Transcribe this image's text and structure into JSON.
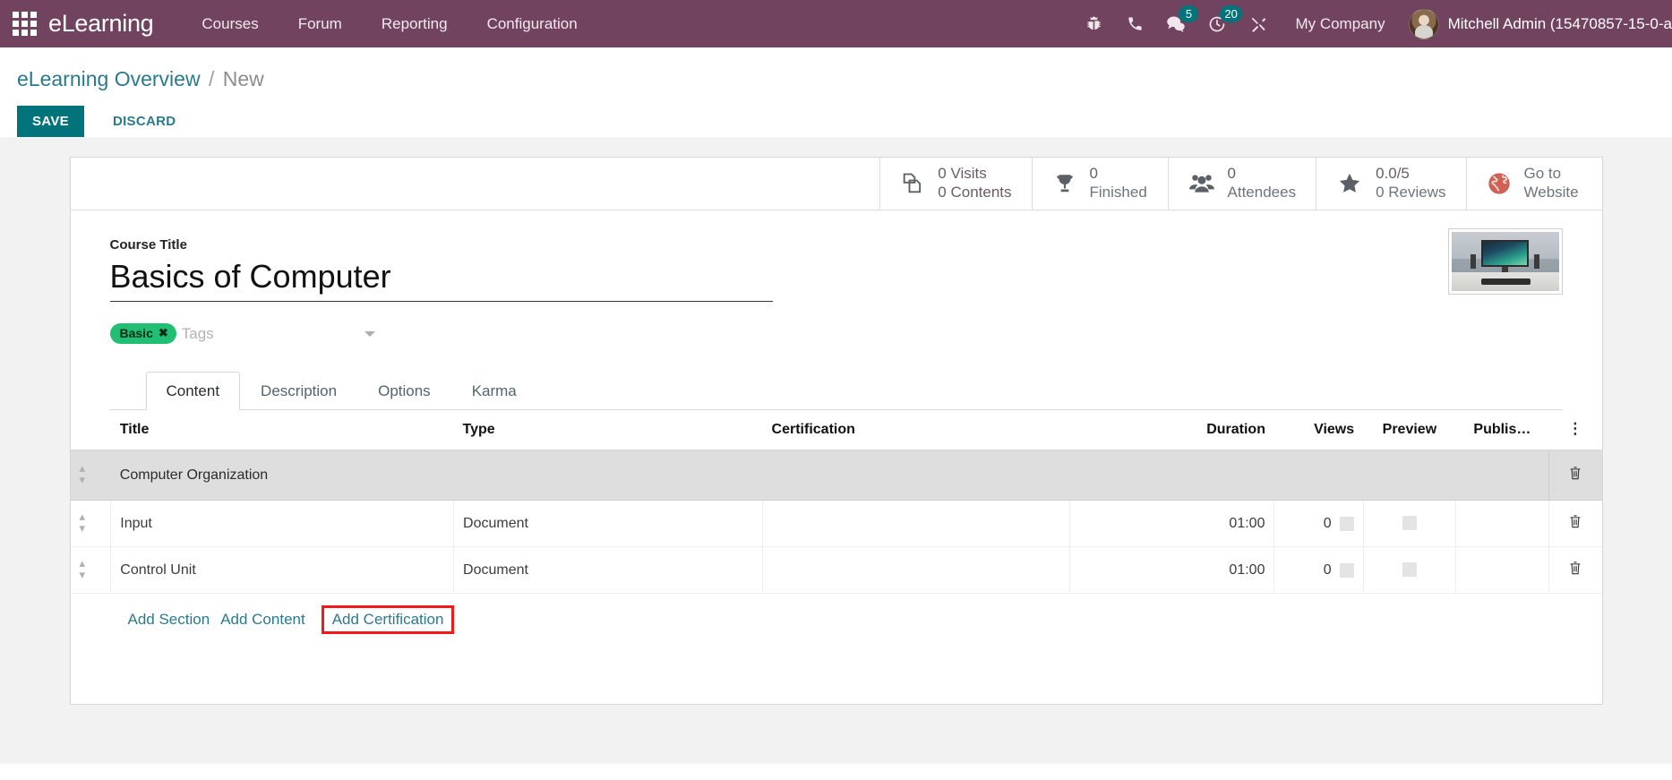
{
  "navbar": {
    "apps_icon": "apps-grid-icon",
    "brand": "eLearning",
    "menu": [
      {
        "label": "Courses"
      },
      {
        "label": "Forum"
      },
      {
        "label": "Reporting"
      },
      {
        "label": "Configuration"
      }
    ],
    "icons": [
      {
        "name": "bug-icon",
        "badge": null
      },
      {
        "name": "phone-icon",
        "badge": null
      },
      {
        "name": "messages-icon",
        "badge": "5"
      },
      {
        "name": "activities-clock-icon",
        "badge": "20"
      },
      {
        "name": "tools-icon",
        "badge": null
      }
    ],
    "company": "My Company",
    "username": "Mitchell Admin (15470857-15-0-a",
    "bg_color": "#71435F",
    "badge_color": "#00747A"
  },
  "control_panel": {
    "breadcrumb_root": "eLearning Overview",
    "breadcrumb_separator": "/",
    "breadcrumb_current": "New",
    "save_label": "SAVE",
    "discard_label": "DISCARD",
    "save_color": "#00747A"
  },
  "stat_buttons": [
    {
      "icon": "pages-copy-icon",
      "line1": "0 Visits",
      "line2": "0 Contents"
    },
    {
      "icon": "trophy-icon",
      "line1": "0",
      "line2": "Finished"
    },
    {
      "icon": "attendees-people-icon",
      "line1": "0",
      "line2": "Attendees"
    },
    {
      "icon": "star-icon",
      "line1": "0.0/5",
      "line2": "0 Reviews"
    },
    {
      "icon": "globe-website-icon",
      "line1": "Go to",
      "line2": "Website"
    }
  ],
  "form": {
    "title_label": "Course Title",
    "title_value": "Basics of Computer",
    "tags": [
      {
        "label": "Basic",
        "color": "#21BF73"
      }
    ],
    "tags_placeholder": "Tags",
    "course_image_alt": "computer-desk-setup-photo"
  },
  "notebook": {
    "tabs": [
      {
        "label": "Content",
        "active": true
      },
      {
        "label": "Description",
        "active": false
      },
      {
        "label": "Options",
        "active": false
      },
      {
        "label": "Karma",
        "active": false
      }
    ]
  },
  "content_table": {
    "columns": [
      "Title",
      "Type",
      "Certification",
      "Duration",
      "Views",
      "Preview",
      "Publis…"
    ],
    "options_icon": "vertical-dots-icon",
    "rows": [
      {
        "kind": "section",
        "title": "Computer Organization",
        "type": "",
        "certification": "",
        "duration": "",
        "views": "",
        "preview": false,
        "published": false
      },
      {
        "kind": "content",
        "title": "Input",
        "type": "Document",
        "certification": "",
        "duration": "01:00",
        "views": "0",
        "preview": false,
        "published": false
      },
      {
        "kind": "content",
        "title": "Control Unit",
        "type": "Document",
        "certification": "",
        "duration": "01:00",
        "views": "0",
        "preview": false,
        "published": false
      }
    ],
    "add_links": [
      {
        "label": "Add Section",
        "highlighted": false
      },
      {
        "label": "Add Content",
        "highlighted": false
      },
      {
        "label": "Add Certification",
        "highlighted": true
      }
    ],
    "highlight_color": "#F51818"
  }
}
